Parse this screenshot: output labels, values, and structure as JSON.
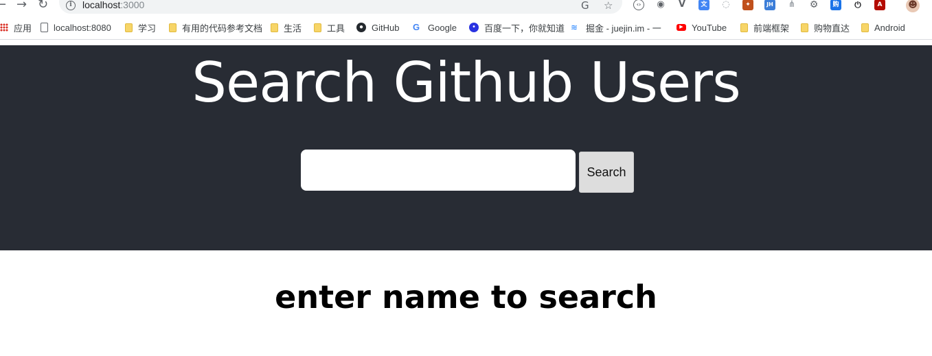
{
  "browser": {
    "address": {
      "host": "localhost",
      "port": ":3000"
    }
  },
  "bookmarks": [
    {
      "label": "应用",
      "icon": "apps-grid-icon"
    },
    {
      "label": "localhost:8080",
      "icon": "page-icon"
    },
    {
      "label": "学习",
      "icon": "folder-icon"
    },
    {
      "label": "有用的代码参考文档",
      "icon": "folder-icon"
    },
    {
      "label": "生活",
      "icon": "folder-icon"
    },
    {
      "label": "工具",
      "icon": "folder-icon"
    },
    {
      "label": "GitHub",
      "icon": "github-icon"
    },
    {
      "label": "Google",
      "icon": "google-icon"
    },
    {
      "label": "百度一下，你就知道",
      "icon": "baidu-icon"
    },
    {
      "label": "掘金 - juejin.im - 一",
      "icon": "juejin-icon"
    },
    {
      "label": "YouTube",
      "icon": "youtube-icon"
    },
    {
      "label": "前端框架",
      "icon": "folder-icon"
    },
    {
      "label": "购物直达",
      "icon": "folder-icon"
    },
    {
      "label": "Android",
      "icon": "folder-icon"
    }
  ],
  "extensions": [
    {
      "icon": "translate-icon",
      "text": "G"
    },
    {
      "icon": "star-icon",
      "text": "☆"
    },
    {
      "icon": "code-ext-icon",
      "text": "‹›"
    },
    {
      "icon": "camera-ext-icon",
      "text": "◉"
    },
    {
      "icon": "vue-devtools-icon",
      "text": "V"
    },
    {
      "icon": "google-translate-icon",
      "text": "文"
    },
    {
      "icon": "circle-ext-icon",
      "text": "◌"
    },
    {
      "icon": "fox-ext-icon",
      "text": "✦"
    },
    {
      "icon": "jh-ext-icon",
      "text": "JH"
    },
    {
      "icon": "tree-ext-icon",
      "text": "⋔"
    },
    {
      "icon": "gear-ext-icon",
      "text": "⚙"
    },
    {
      "icon": "shop-ext-icon",
      "text": "购"
    },
    {
      "icon": "power-ext-icon",
      "text": "⏻"
    },
    {
      "icon": "pdf-ext-icon",
      "text": "A"
    },
    {
      "icon": "profile-avatar-icon",
      "text": "☻"
    }
  ],
  "header": {
    "title": "Search Github Users",
    "search": {
      "placeholder": "",
      "value": "",
      "button_label": "Search"
    }
  },
  "main": {
    "prompt": "enter name to search"
  },
  "colors": {
    "header_bg": "#282c34",
    "folder": "#f7d568"
  }
}
